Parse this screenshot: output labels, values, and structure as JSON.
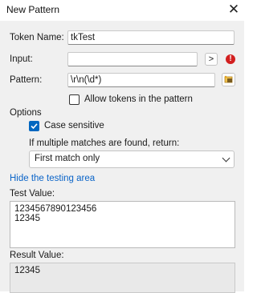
{
  "window": {
    "title": "New Pattern",
    "close_glyph": "✕"
  },
  "form": {
    "token_name_label": "Token Name:",
    "token_name_value": "tkTest",
    "input_label": "Input:",
    "input_value": "",
    "input_button_label": ">",
    "error_glyph": "!",
    "pattern_label": "Pattern:",
    "pattern_value": "\\r\\n(\\d*)",
    "allow_tokens_label": "Allow tokens in the pattern",
    "allow_tokens_checked": false
  },
  "options": {
    "heading": "Options",
    "case_sensitive_label": "Case sensitive",
    "case_sensitive_checked": true,
    "multiple_matches_label": "If multiple matches are found, return:",
    "multiple_matches_selected": "First match only"
  },
  "testing": {
    "toggle_link": "Hide the testing area",
    "test_value_label": "Test Value:",
    "test_value_text": "1234567890123456\n12345",
    "result_value_label": "Result Value:",
    "result_value_text": "12345"
  }
}
